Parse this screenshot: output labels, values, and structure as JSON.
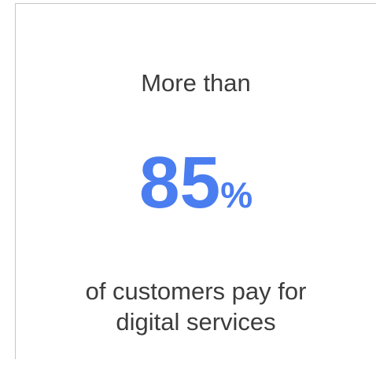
{
  "stat_card": {
    "lead_text": "More than",
    "value": "85",
    "unit": "%",
    "description_line1": "of customers pay for",
    "description_line2": "digital services"
  },
  "colors": {
    "accent": "#4a7df0",
    "text": "#3c3c3c",
    "border": "#c6c6c6"
  }
}
